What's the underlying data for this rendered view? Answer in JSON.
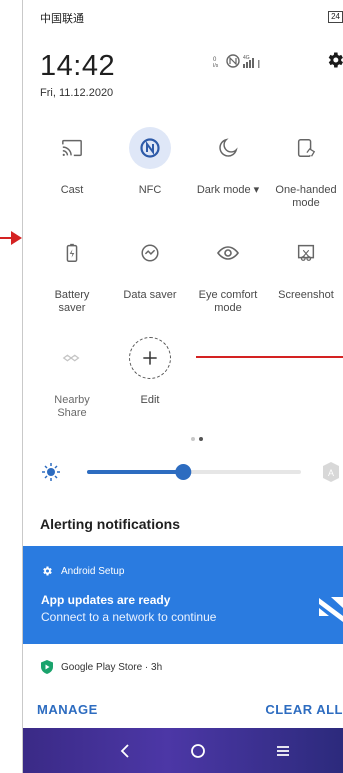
{
  "status_bar": {
    "carrier": "中国联通",
    "battery": "24"
  },
  "header": {
    "time": "14:42",
    "date": "Fri, 11.12.2020",
    "net_speed": "0 B/s",
    "net_type": "4G"
  },
  "tiles": [
    {
      "label": "Cast",
      "icon": "cast-icon"
    },
    {
      "label": "NFC",
      "icon": "nfc-icon",
      "active": true
    },
    {
      "label": "Dark mode ▾",
      "icon": "moon-icon"
    },
    {
      "label": "One-handed\nmode",
      "icon": "one-handed-icon"
    },
    {
      "label": "Battery\nsaver",
      "icon": "battery-saver-icon"
    },
    {
      "label": "Data saver",
      "icon": "data-saver-icon"
    },
    {
      "label": "Eye comfort\nmode",
      "icon": "eye-icon"
    },
    {
      "label": "Screenshot",
      "icon": "screenshot-icon"
    },
    {
      "label": "Nearby\nShare",
      "icon": "nearby-share-icon",
      "dim": true
    },
    {
      "label": "Edit",
      "icon": "plus-icon"
    }
  ],
  "pager": {
    "pages": 2,
    "current": 2
  },
  "brightness": {
    "level": 0.45,
    "auto_label": "A"
  },
  "notifications": {
    "section_title": "Alerting notifications",
    "card": {
      "app": "Android Setup",
      "title": "App updates are ready",
      "text": "Connect to a network to continue",
      "color": "#2a7be0"
    },
    "second": {
      "app": "Google Play Store · 3h"
    },
    "manage_label": "MANAGE",
    "clear_label": "CLEAR ALL"
  },
  "colors": {
    "accent": "#2d6cc0",
    "annotation_red": "#d42222",
    "nav": "#3a2a86"
  }
}
